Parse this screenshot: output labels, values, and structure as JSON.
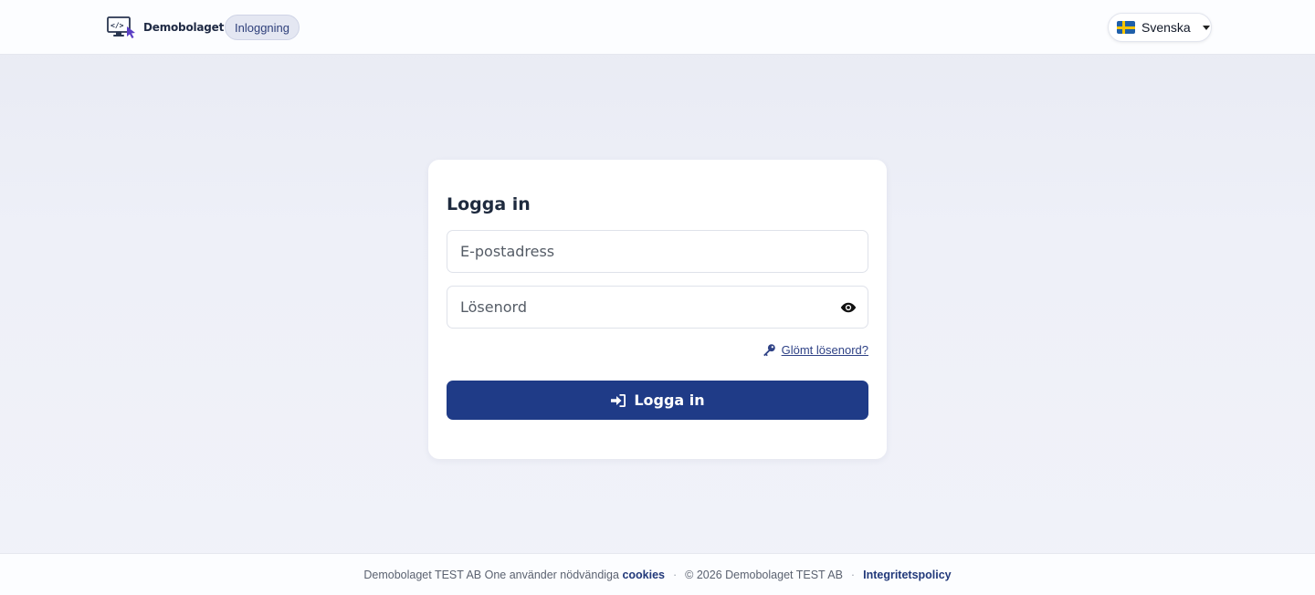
{
  "header": {
    "brand_name": "Demobolaget",
    "page_pill": "Inloggning",
    "language": {
      "label": "Svenska",
      "flag_icon": "sweden-flag-icon"
    }
  },
  "login": {
    "title": "Logga in",
    "email_placeholder": "E-postadress",
    "password_placeholder": "Lösenord",
    "show_password_icon": "eye-icon",
    "forgot_password": "Glömt lösenord?",
    "forgot_icon": "key-icon",
    "submit_label": "Logga in",
    "submit_icon": "sign-in-icon"
  },
  "footer": {
    "cookie_text": "Demobolaget TEST AB One använder nödvändiga",
    "cookie_link": "cookies",
    "separator": "·",
    "copyright": "© 2026 Demobolaget TEST AB",
    "privacy_link": "Integritetspolicy"
  },
  "colors": {
    "primary": "#1f3b87",
    "link": "#2f4286",
    "background": "#eef0f8"
  }
}
